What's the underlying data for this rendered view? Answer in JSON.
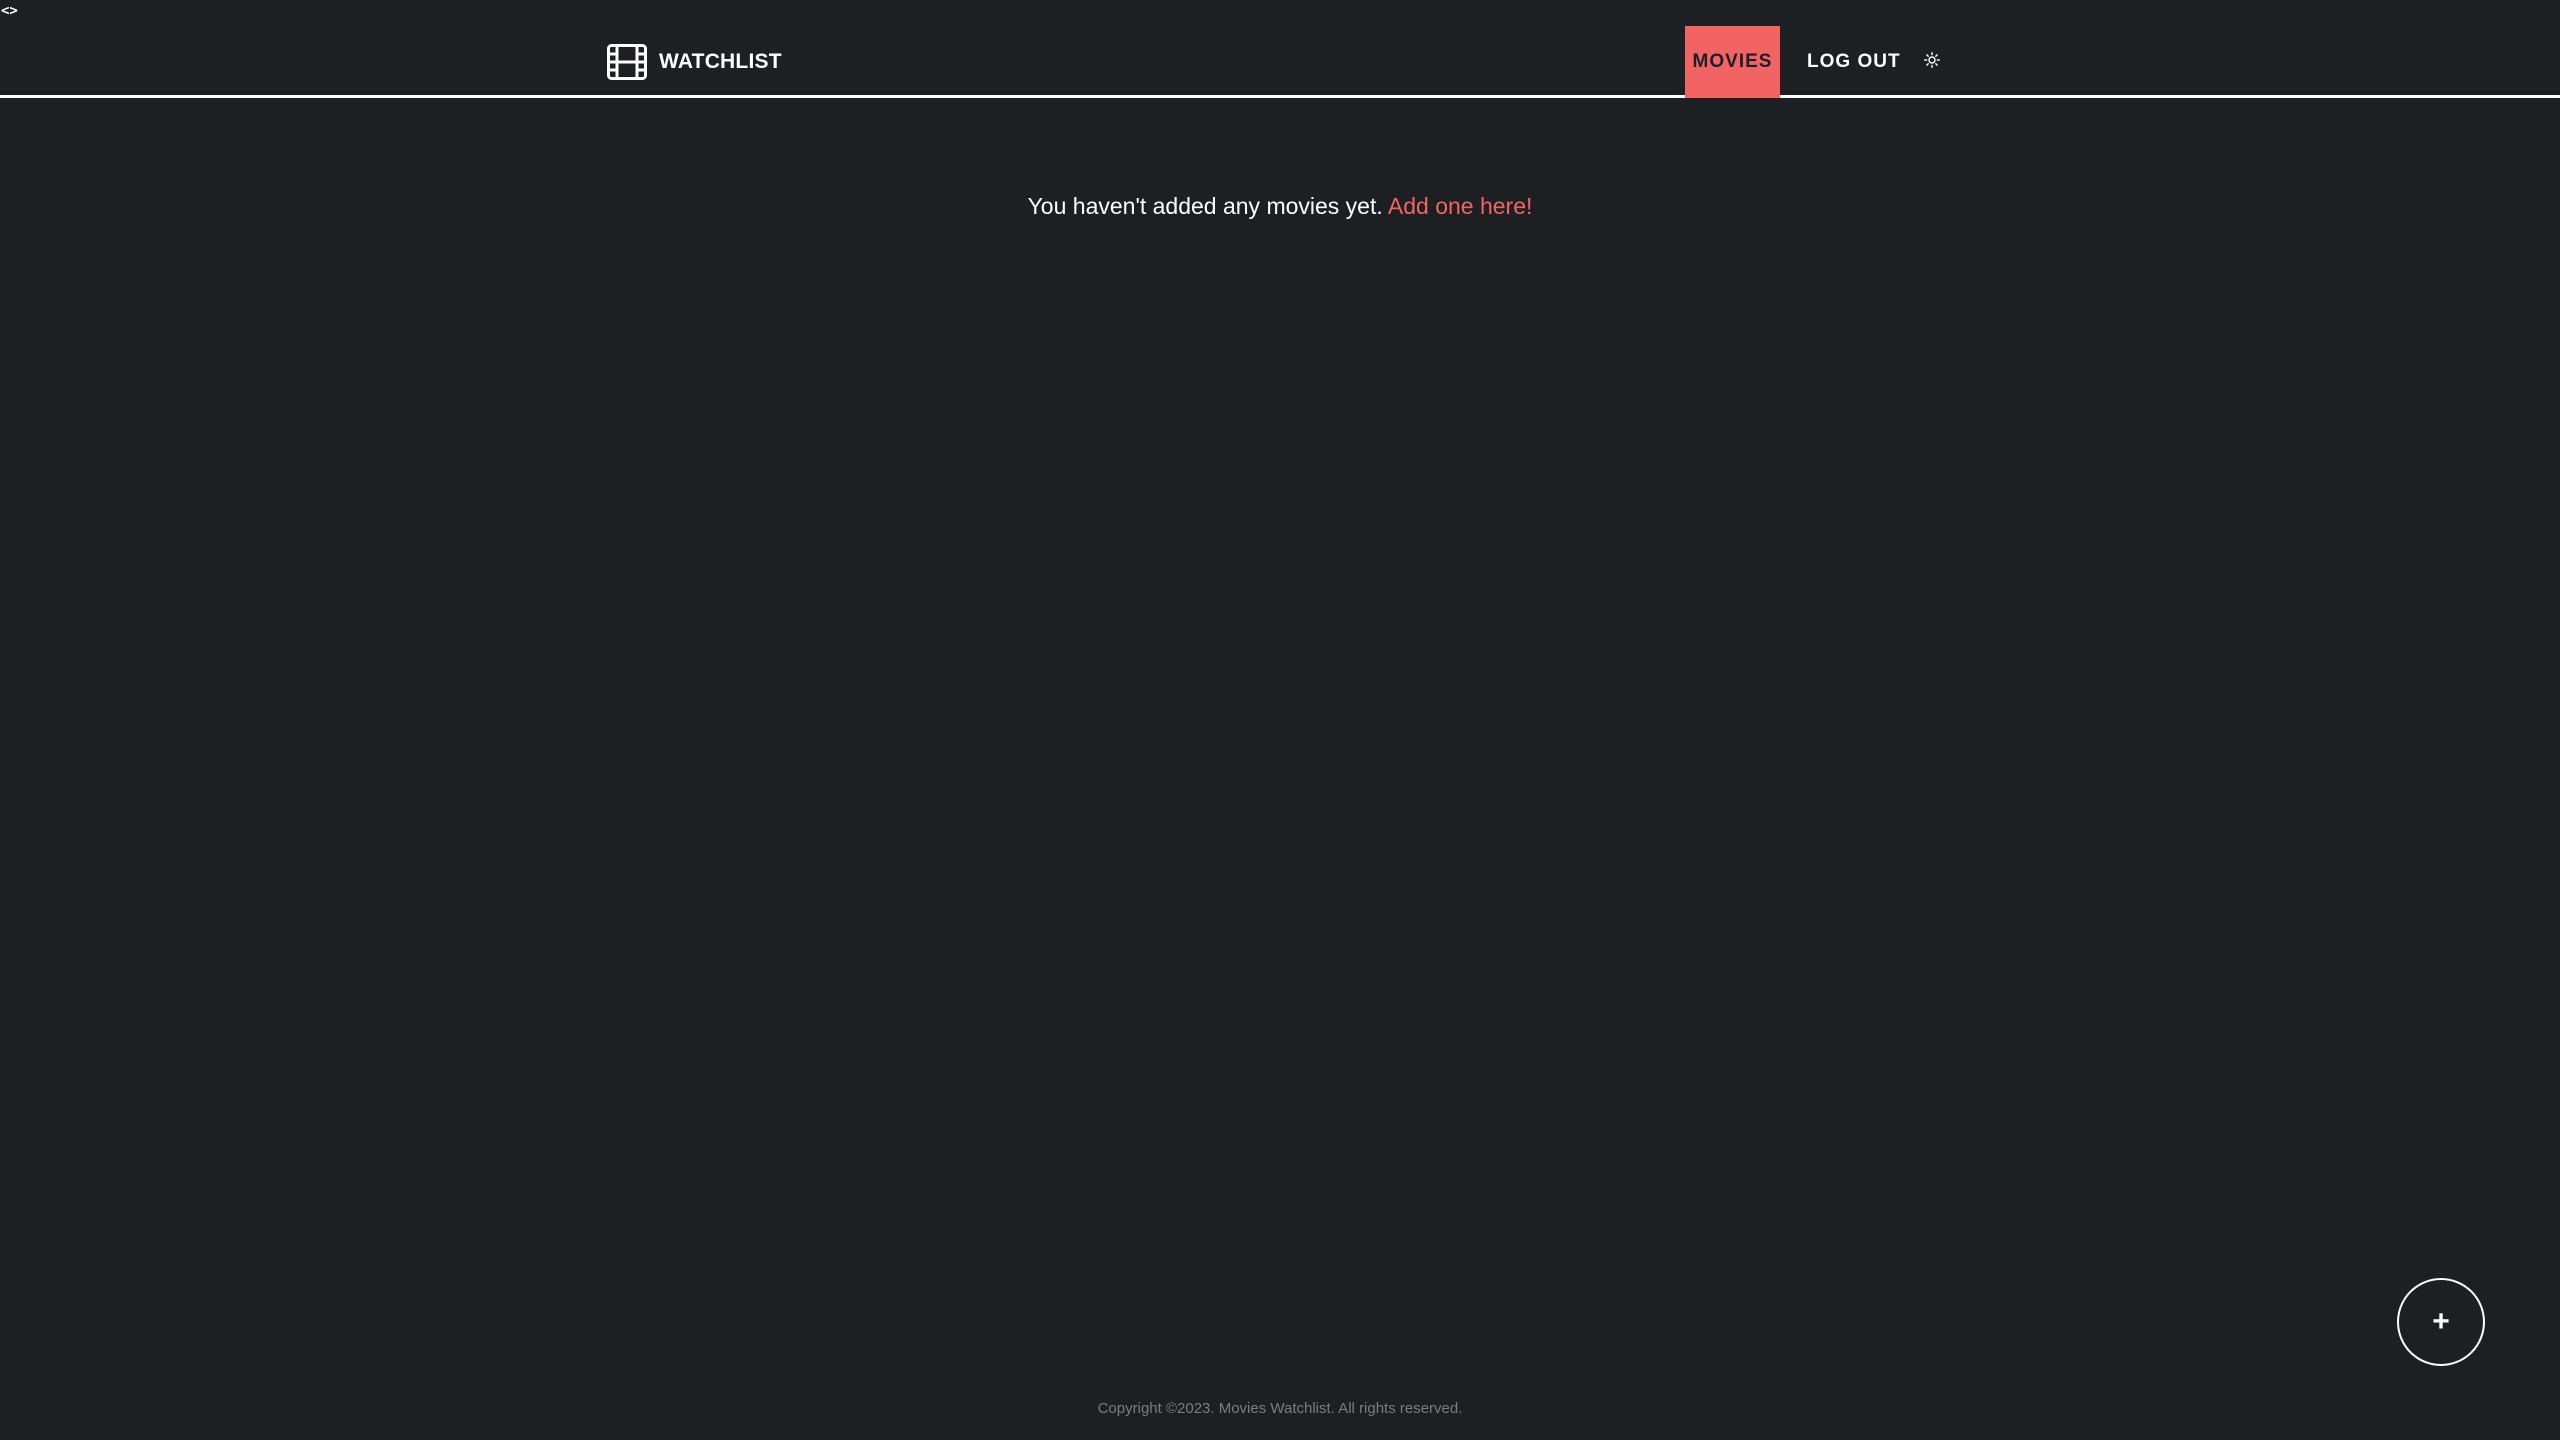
{
  "debug": {
    "corner_text": "<>"
  },
  "header": {
    "brand": {
      "icon": "film-icon",
      "label": "WATCHLIST"
    },
    "nav": {
      "movies_label": "MOVIES",
      "logout_label": "LOG OUT",
      "theme_icon": "sun-icon"
    }
  },
  "main": {
    "empty_text": "You haven't added any movies yet.",
    "empty_link_text": "Add one here!"
  },
  "fab": {
    "label": "+",
    "icon": "plus-icon"
  },
  "footer": {
    "copyright": "Copyright ©2023. Movies Watchlist. All rights reserved."
  },
  "colors": {
    "background": "#1d2023",
    "accent": "#f26464",
    "text": "#ffffff",
    "muted": "#7a7d80"
  }
}
